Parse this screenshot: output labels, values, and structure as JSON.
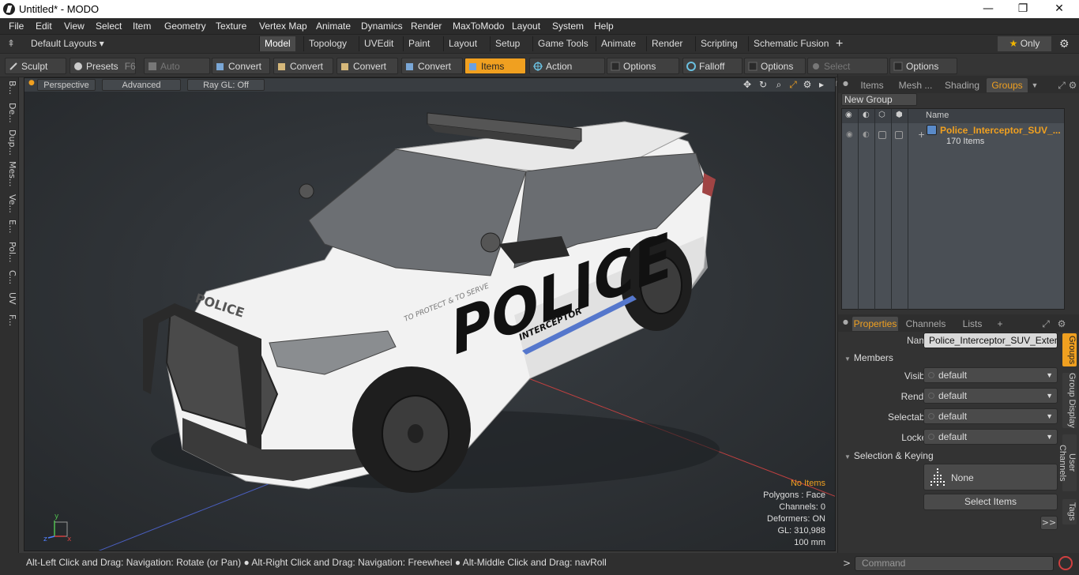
{
  "window": {
    "title": "Untitled* - MODO",
    "minimize": "—",
    "maximize": "❐",
    "close": "✕"
  },
  "menu": [
    "File",
    "Edit",
    "View",
    "Select",
    "Item",
    "Geometry",
    "Texture",
    "Vertex Map",
    "Animate",
    "Dynamics",
    "Render",
    "MaxToModo",
    "Layout",
    "System",
    "Help"
  ],
  "layout_bar": {
    "layouts_label": "Default Layouts",
    "tabs": [
      "Model",
      "Topology",
      "UVEdit",
      "Paint",
      "Layout",
      "Setup",
      "Game Tools",
      "Animate",
      "Render",
      "Scripting",
      "Schematic Fusion"
    ],
    "active_tab": "Model",
    "add": "+",
    "only_label": "Only"
  },
  "toolbar": {
    "sculpt": "Sculpt",
    "presets": "Presets",
    "presets_key": "F6",
    "auto_select": "Auto Select",
    "convert1": "Convert",
    "convert2": "Convert",
    "convert3": "Convert",
    "convert4": "Convert",
    "items": "Items",
    "action_center": "Action Center",
    "options1": "Options",
    "falloff": "Falloff",
    "options2": "Options",
    "select_through": "Select Through",
    "options3": "Options"
  },
  "left_strip": [
    "B...",
    "De...",
    "Dup...",
    "Mes...",
    "Ve...",
    "E...",
    "Pol...",
    "C...",
    "UV",
    "F..."
  ],
  "viewport": {
    "view_name": "Perspective",
    "advanced": "Advanced",
    "raygl": "Ray GL: Off",
    "car_texts": {
      "hood": "POLICE",
      "side": "POLICE",
      "slogan": "TO PROTECT & TO SERVE",
      "interceptor": "INTERCEPTOR"
    },
    "stats": {
      "selection": "No Items",
      "polygons": "Polygons : Face",
      "channels": "Channels: 0",
      "deformers": "Deformers: ON",
      "gl": "GL: 310,988",
      "scale": "100 mm"
    },
    "axis": {
      "y": "y",
      "x": "x",
      "z": "z"
    }
  },
  "status": "Alt-Left Click and Drag: Navigation: Rotate (or Pan) ● Alt-Right Click and Drag: Navigation: Freewheel ● Alt-Middle Click and Drag: navRoll",
  "groups_panel": {
    "tabs": [
      "Items",
      "Mesh ...",
      "Shading",
      "Groups"
    ],
    "active_tab": "Groups",
    "new_group": "New Group",
    "name_header": "Name",
    "group_name": "Police_Interceptor_SUV_...",
    "group_count": "170 Items"
  },
  "properties_panel": {
    "tabs": [
      "Properties",
      "Channels",
      "Lists"
    ],
    "add": "+",
    "name_label": "Name",
    "name_value": "Police_Interceptor_SUV_Exterior",
    "members_section": "Members",
    "visible_label": "Visible",
    "visible_value": "default",
    "render_label": "Render",
    "render_value": "default",
    "selectable_label": "Selectable",
    "selectable_value": "default",
    "locked_label": "Locked",
    "locked_value": "default",
    "selection_section": "Selection & Keying",
    "none_label": "None",
    "select_items": "Select Items",
    "more": ">>",
    "vtabs": [
      "Groups",
      "Group Display",
      "User Channels",
      "Tags"
    ]
  },
  "command": {
    "prompt": ">",
    "placeholder": "Command"
  },
  "colors": {
    "accent": "#f0a020",
    "viewport_bg": "#2c3034"
  }
}
